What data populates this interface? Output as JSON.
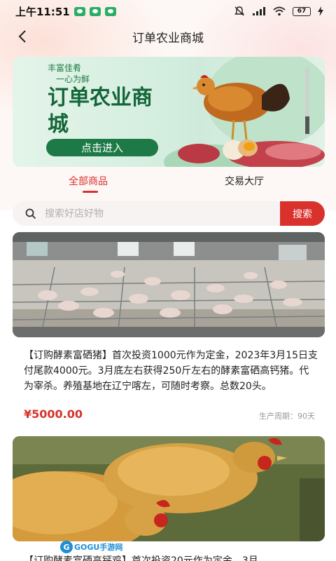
{
  "status_bar": {
    "time": "上午11:51",
    "battery": "67"
  },
  "header": {
    "title": "订单农业商城"
  },
  "banner": {
    "slogan_line1": "丰富佳肴",
    "slogan_line2": "一心为鲜",
    "title": "订单农业商城",
    "cta": "点击进入"
  },
  "tabs": [
    {
      "label": "全部商品",
      "active": true
    },
    {
      "label": "交易大厅",
      "active": false
    }
  ],
  "search": {
    "placeholder": "搜索好店好物",
    "button": "搜索"
  },
  "products": [
    {
      "description": "【订购酵素富硒猪】首次投资1000元作为定金，2023年3月15日支付尾款4000元。3月底左右获得250斤左右的酵素富硒高钙猪。代为宰杀。养殖基地在辽宁喀左，可随时考察。总数20头。",
      "price": "¥5000.00",
      "cycle": "生产周期：90天"
    },
    {
      "description": "【订购酵素富硒高钙鸡】首次投资20元作为定金，3月"
    }
  ],
  "watermark": {
    "logo_letter": "G",
    "brand": "GOGU",
    "sub": "手游网"
  },
  "colors": {
    "accent": "#d9322d",
    "banner_green": "#1d7a47"
  }
}
